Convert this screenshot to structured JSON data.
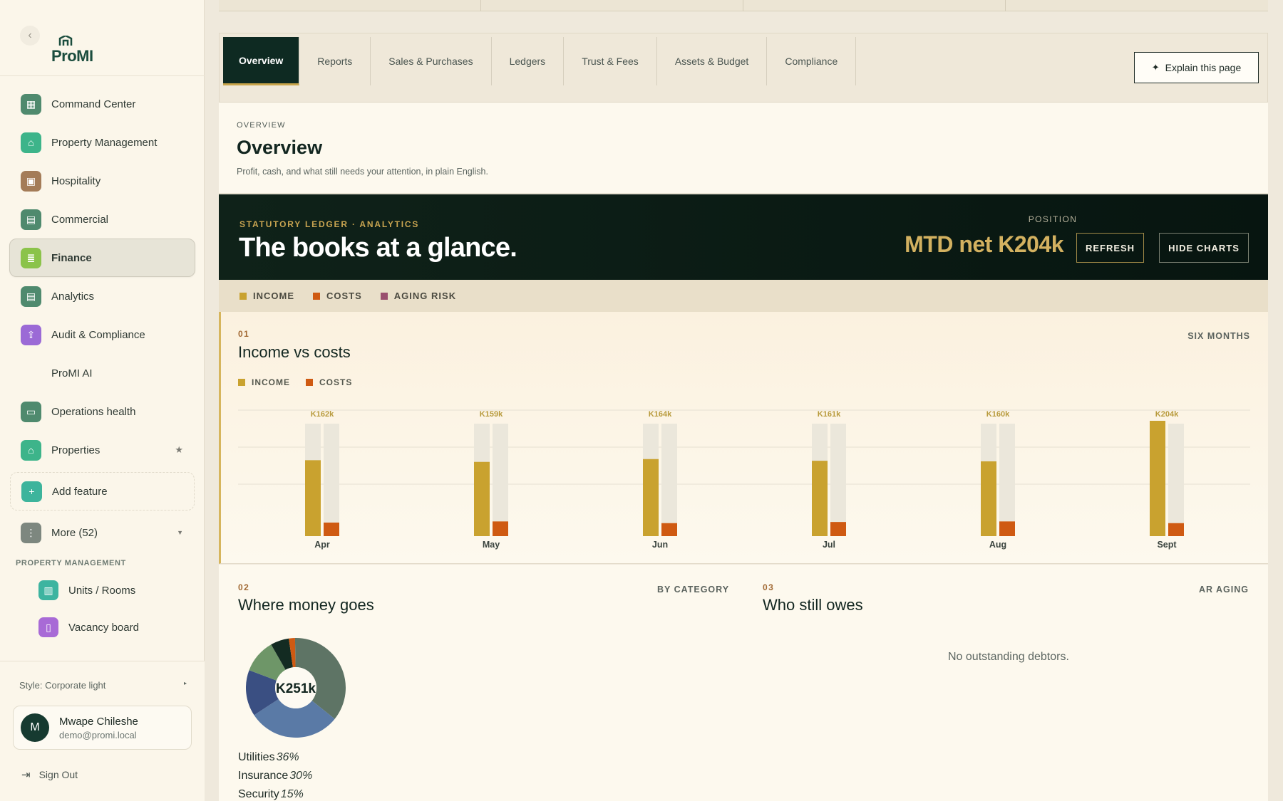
{
  "sidebar": {
    "brand": "ProMI",
    "items": [
      {
        "label": "Command Center",
        "icon": "grid-icon",
        "color": "#4f8a6e"
      },
      {
        "label": "Property Management",
        "icon": "home-icon",
        "color": "#3db48a"
      },
      {
        "label": "Hospitality",
        "icon": "calendar-icon",
        "color": "#a47c58"
      },
      {
        "label": "Commercial",
        "icon": "document-icon",
        "color": "#4f8a6e"
      },
      {
        "label": "Finance",
        "icon": "ledger-icon",
        "color": "#8bc34a",
        "active": true
      },
      {
        "label": "Analytics",
        "icon": "document-icon",
        "color": "#4f8a6e"
      },
      {
        "label": "Audit & Compliance",
        "icon": "upload-doc-icon",
        "color": "#9b6ad6"
      },
      {
        "label": "ProMI AI",
        "icon": "",
        "color": ""
      },
      {
        "label": "Operations health",
        "icon": "monitor-icon",
        "color": "#4f8a6e"
      },
      {
        "label": "Properties",
        "icon": "home-icon",
        "color": "#3db48a",
        "starred": true
      }
    ],
    "add_feature": "Add feature",
    "more": "More (52)",
    "section_label": "PROPERTY MANAGEMENT",
    "sub_items": [
      {
        "label": "Units / Rooms",
        "icon": "building-icon",
        "color": "#3db4a0"
      },
      {
        "label": "Vacancy board",
        "icon": "door-icon",
        "color": "#a86ad6"
      }
    ],
    "style_label": "Style: Corporate light",
    "user": {
      "initial": "M",
      "name": "Mwape Chileshe",
      "email": "demo@promi.local"
    },
    "sign_out": "Sign Out"
  },
  "tabs": [
    "Overview",
    "Reports",
    "Sales & Purchases",
    "Ledgers",
    "Trust & Fees",
    "Assets & Budget",
    "Compliance"
  ],
  "explain_button": "Explain this page",
  "overview": {
    "eyebrow": "OVERVIEW",
    "title": "Overview",
    "subtitle": "Profit, cash, and what still needs your attention, in plain English."
  },
  "hero": {
    "eyebrow": "STATUTORY LEDGER · ANALYTICS",
    "title": "The books at a glance.",
    "position_label": "POSITION",
    "position_value": "MTD net K204k",
    "refresh": "REFRESH",
    "hide_charts": "HIDE CHARTS"
  },
  "legend": [
    {
      "label": "INCOME",
      "color": "#c9a22f"
    },
    {
      "label": "COSTS",
      "color": "#cf5a12"
    },
    {
      "label": "AGING RISK",
      "color": "#9a4f6e"
    }
  ],
  "panel_income": {
    "number": "01",
    "title": "Income vs costs",
    "tag": "SIX MONTHS",
    "legend": [
      {
        "label": "INCOME",
        "color": "#c9a22f"
      },
      {
        "label": "COSTS",
        "color": "#cf5a12"
      }
    ]
  },
  "chart_data": {
    "type": "bar",
    "categories": [
      "Apr",
      "May",
      "Jun",
      "Jul",
      "Aug",
      "Sept"
    ],
    "series": [
      {
        "name": "INCOME",
        "values": [
          162,
          159,
          164,
          161,
          160,
          204
        ]
      },
      {
        "name": "COSTS",
        "values": [
          24,
          26,
          23,
          25,
          26,
          23
        ]
      }
    ],
    "data_labels": [
      "K162k",
      "K159k",
      "K164k",
      "K161k",
      "K160k",
      "K204k"
    ],
    "ylim": [
      0,
      204
    ],
    "grid": true,
    "legend_position": "top-left"
  },
  "panel_where": {
    "number": "02",
    "title": "Where money goes",
    "tag": "BY CATEGORY",
    "center_label": "K251k",
    "breakdown": [
      {
        "name": "Utilities",
        "pct": "36%"
      },
      {
        "name": "Insurance",
        "pct": "30%"
      },
      {
        "name": "Security",
        "pct": "15%"
      }
    ]
  },
  "panel_owes": {
    "number": "03",
    "title": "Who still owes",
    "tag": "AR AGING",
    "empty": "No outstanding debtors."
  }
}
